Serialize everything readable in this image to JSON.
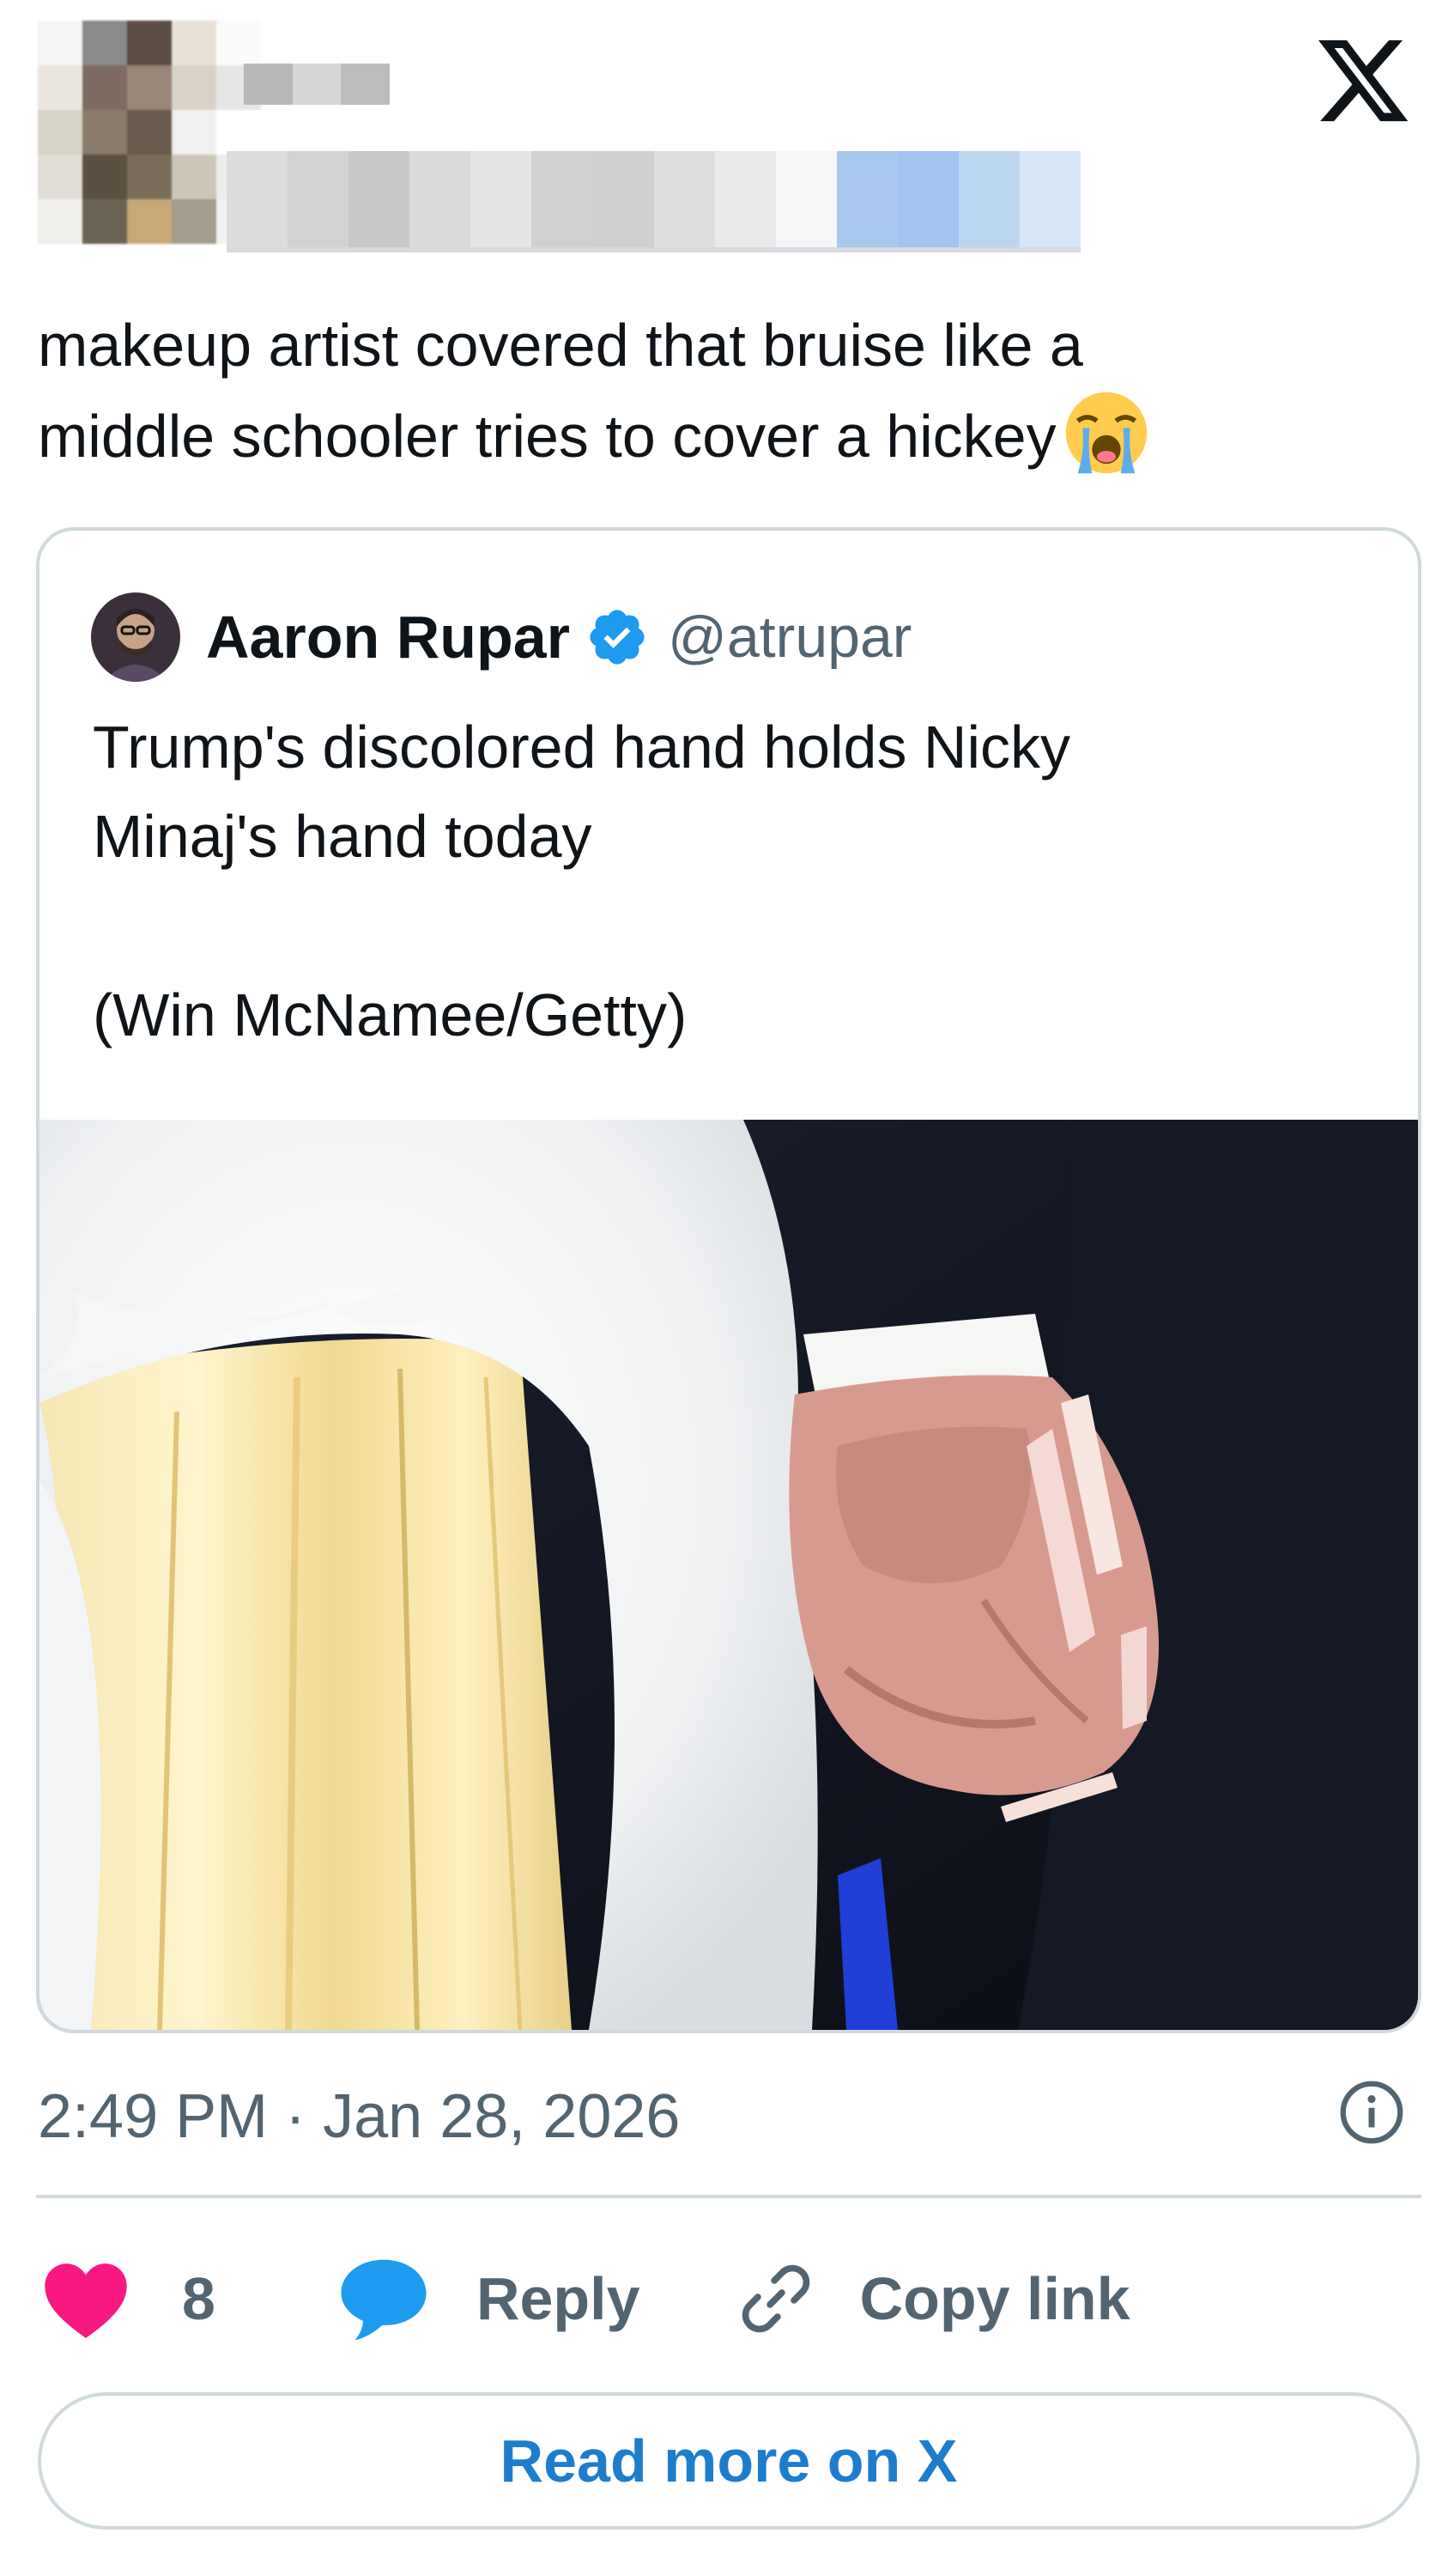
{
  "colors": {
    "text_primary": "#0f1419",
    "text_secondary": "#536471",
    "border": "#cfd9de",
    "verified_blue": "#1d9bf0",
    "like_pink": "#f91880",
    "link_blue": "#1d7dcc"
  },
  "header": {
    "author_avatar": "pixelated-avatar",
    "author_name": "pixelated",
    "logo_icon": "x-logo"
  },
  "tweet": {
    "text": "makeup artist covered that bruise like a\nmiddle schooler tries to cover a hickey",
    "emoji": "loudly-crying-face"
  },
  "quoted_tweet": {
    "author_name": "Aaron Rupar",
    "verified": true,
    "handle": "@atrupar",
    "text": "Trump's discolored hand holds Nicky\nMinaj's hand today\n\n(Win McNamee/Getty)",
    "photo": "photo-of-two-hands-holding-white-fur-coat-and-dark-suit"
  },
  "meta": {
    "timestamp": "2:49 PM · Jan 28, 2026",
    "info_icon": "info-icon"
  },
  "actions": {
    "like_count": "8",
    "reply_label": "Reply",
    "copy_label": "Copy link"
  },
  "read_more": {
    "label": "Read more on X"
  }
}
